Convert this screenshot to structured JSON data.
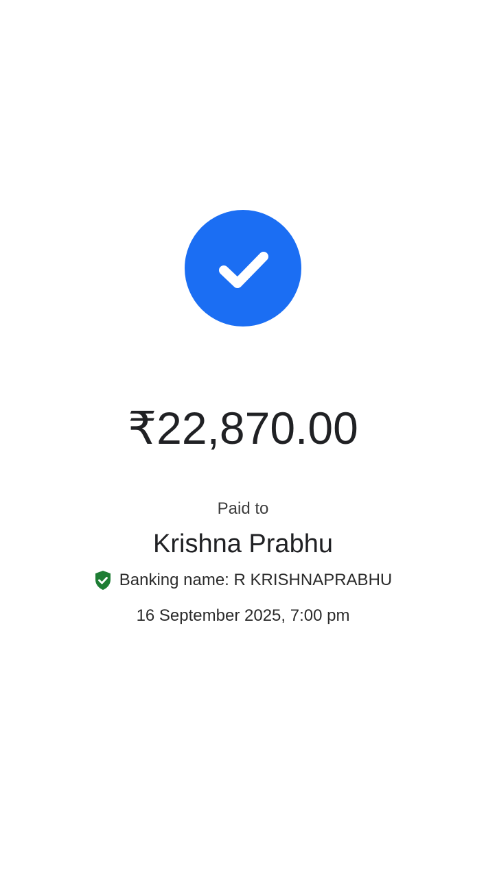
{
  "status": {
    "icon": "check-icon",
    "badge_color": "#1b6ef3"
  },
  "payment": {
    "amount": "₹22,870.00",
    "paid_to_label": "Paid to",
    "payee_name": "Krishna Prabhu",
    "verified_icon": "verified-shield-icon",
    "verified_color": "#1e7d34",
    "banking_name": "Banking name: R KRISHNAPRABHU",
    "timestamp": "16 September 2025, 7:00 pm"
  }
}
